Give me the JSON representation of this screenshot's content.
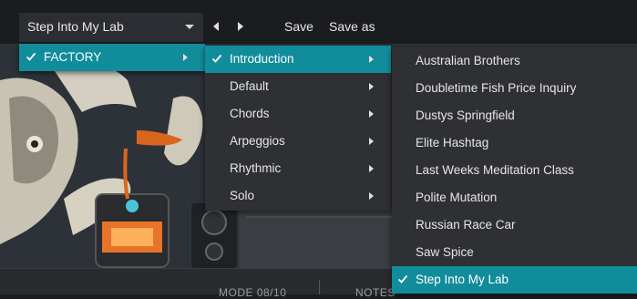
{
  "toolbar": {
    "preset_name": "Step Into My Lab",
    "save_label": "Save",
    "save_as_label": "Save as"
  },
  "bottom_bar": {
    "mode_text": "MODE 08/10",
    "notes_text": "NOTES"
  },
  "colors": {
    "accent": "#118c9b",
    "menu_bg": "#2f3034",
    "toolbar_bg": "#1b1c1f"
  },
  "menus": {
    "bank": {
      "items": [
        {
          "label": "FACTORY",
          "selected": true,
          "has_submenu": true
        }
      ]
    },
    "category": {
      "items": [
        {
          "label": "Introduction",
          "selected": true,
          "has_submenu": true
        },
        {
          "label": "Default",
          "selected": false,
          "has_submenu": true
        },
        {
          "label": "Chords",
          "selected": false,
          "has_submenu": true
        },
        {
          "label": "Arpeggios",
          "selected": false,
          "has_submenu": true
        },
        {
          "label": "Rhythmic",
          "selected": false,
          "has_submenu": true
        },
        {
          "label": "Solo",
          "selected": false,
          "has_submenu": true
        }
      ]
    },
    "presets": {
      "items": [
        {
          "label": "Australian Brothers",
          "selected": false
        },
        {
          "label": "Doubletime Fish Price Inquiry",
          "selected": false
        },
        {
          "label": "Dustys Springfield",
          "selected": false
        },
        {
          "label": "Elite Hashtag",
          "selected": false
        },
        {
          "label": "Last Weeks Meditation Class",
          "selected": false
        },
        {
          "label": "Polite Mutation",
          "selected": false
        },
        {
          "label": "Russian Race Car",
          "selected": false
        },
        {
          "label": "Saw Spice",
          "selected": false
        },
        {
          "label": "Step Into My Lab",
          "selected": true
        }
      ]
    }
  }
}
